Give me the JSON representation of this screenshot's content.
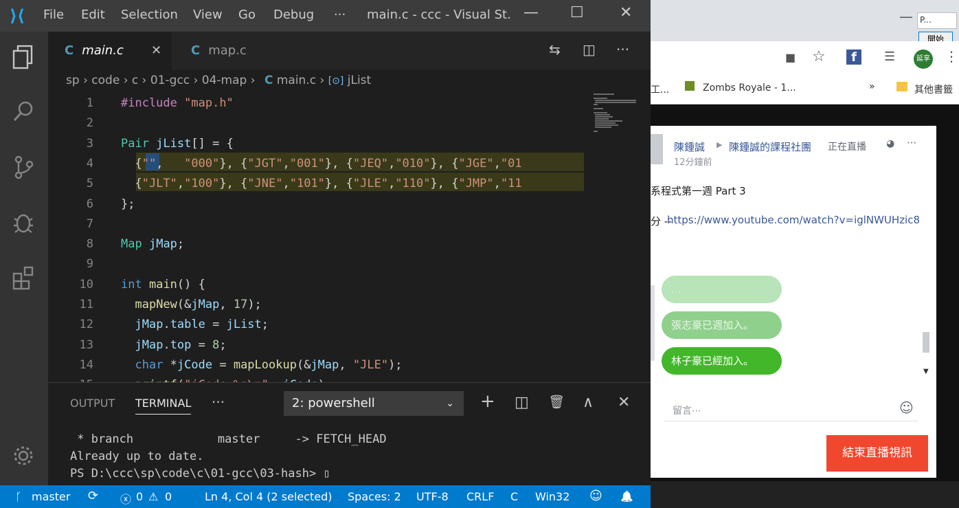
{
  "window": {
    "menu": [
      "File",
      "Edit",
      "Selection",
      "View",
      "Go",
      "Debug"
    ],
    "overflow": "···",
    "title": "main.c - ccc - Visual St...",
    "minimize": "—",
    "maximize": "☐",
    "close": "✕"
  },
  "tabs": [
    {
      "icon": "C",
      "label": "main.c",
      "close": "✕"
    },
    {
      "icon": "C",
      "label": "map.c"
    }
  ],
  "tab_tools": {
    "compare": "⇆",
    "split": "◫",
    "more": "···"
  },
  "breadcrumb": {
    "parts": [
      "sp",
      "code",
      "c",
      "01-gcc",
      "04-map"
    ],
    "file_icon": "C",
    "file": "main.c",
    "symbol_icon": "[⊙]",
    "symbol": "jList",
    "sep": "›"
  },
  "code": [
    {
      "n": "1",
      "html": "<span class='pp'>#include</span> <span class='st'>\"map.h\"</span>"
    },
    {
      "n": "2",
      "html": ""
    },
    {
      "n": "3",
      "html": "<span class='ty'>Pair</span> <span class='vr'>jList</span>[] = {"
    },
    {
      "n": "4",
      "html": "  {<span class='st'>\"\"</span>,   <span class='st'>\"000\"</span>}, {<span class='st'>\"JGT\"</span>,<span class='st'>\"001\"</span>}, {<span class='st'>\"JEQ\"</span>,<span class='st'>\"010\"</span>}, {<span class='st'>\"JGE\"</span>,<span class='st'>\"01</span>"
    },
    {
      "n": "5",
      "html": "  {<span class='st'>\"JLT\"</span>,<span class='st'>\"100\"</span>}, {<span class='st'>\"JNE\"</span>,<span class='st'>\"101\"</span>}, {<span class='st'>\"JLE\"</span>,<span class='st'>\"110\"</span>}, {<span class='st'>\"JMP\"</span>,<span class='st'>\"11</span>"
    },
    {
      "n": "6",
      "html": "};"
    },
    {
      "n": "7",
      "html": ""
    },
    {
      "n": "8",
      "html": "<span class='ty'>Map</span> <span class='vr'>jMap</span>;"
    },
    {
      "n": "9",
      "html": ""
    },
    {
      "n": "10",
      "html": "<span class='kw'>int</span> <span class='fn'>main</span>() {"
    },
    {
      "n": "11",
      "html": "  <span class='fn'>mapNew</span>(&amp;<span class='vr'>jMap</span>, <span class='nm'>17</span>);"
    },
    {
      "n": "12",
      "html": "  <span class='vr'>jMap</span>.<span class='vr'>table</span> = <span class='vr'>jList</span>;"
    },
    {
      "n": "13",
      "html": "  <span class='vr'>jMap</span>.<span class='vr'>top</span> = <span class='nm'>8</span>;"
    },
    {
      "n": "14",
      "html": "  <span class='kw'>char</span> *<span class='vr'>jCode</span> = <span class='fn'>mapLookup</span>(&amp;<span class='vr'>jMap</span>, <span class='st'>\"JLE\"</span>);"
    },
    {
      "n": "15",
      "html": "  <span class='fn'>printf</span>(<span class='st'>\"jCode=%s\\n\"</span>, <span class='vr'>jCode</span>);"
    }
  ],
  "panel": {
    "tabs": [
      "OUTPUT",
      "TERMINAL"
    ],
    "more": "···",
    "terminal_select": "2: powershell",
    "tools": {
      "add": "+",
      "split": "◫",
      "trash": "🗑",
      "up": "∧",
      "close": "✕"
    },
    "lines": [
      " * branch            master     -> FETCH_HEAD",
      "Already up to date.",
      "PS D:\\ccc\\sp\\code\\c\\01-gcc\\03-hash> ▯"
    ]
  },
  "status": {
    "branch": "master",
    "sync": "⟳",
    "errors": "0",
    "warnings": "0",
    "position": "Ln 4, Col 4 (2 selected)",
    "spaces": "Spaces: 2",
    "encoding": "UTF-8",
    "eol": "CRLF",
    "language": "C",
    "platform": "Win32",
    "feedback": "☺",
    "bell": "🔔"
  },
  "browser": {
    "tab_label": "P...",
    "start_button": "開始",
    "bookmarks": [
      "工...",
      "Zombs Royale - 1...",
      "»",
      "其他書籤"
    ],
    "avatar_label": "延享",
    "post": {
      "author": "陳鍾誠",
      "arrow": "▶",
      "group": "陳鍾誠的課程社團",
      "live": "正在直播",
      "time": "12分鐘前",
      "more": "···",
      "title": "系程式第一週 Part 3",
      "link_prefix": "分 -- ",
      "link": "https://www.youtube.com/watch?v=iglNWUHzic8"
    },
    "chat": [
      {
        "text": "...",
        "faded": true
      },
      {
        "text": "張志豪已週加入。",
        "faded": true
      },
      {
        "text": "林子豪已經加入。",
        "faded": false
      }
    ],
    "comment_placeholder": "留言⋯",
    "emoji": "☺",
    "end_button": "結束直播視訊"
  }
}
